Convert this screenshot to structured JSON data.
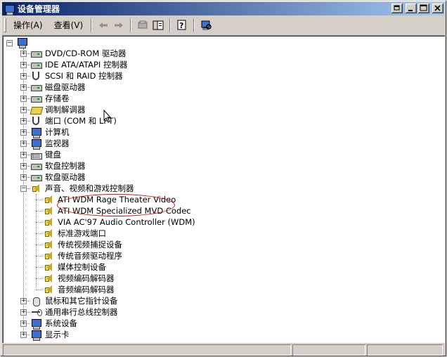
{
  "window": {
    "title": "设备管理器"
  },
  "menu": {
    "action": "操作(A)",
    "view": "查看(V)"
  },
  "toolbar": {
    "icons": [
      "back-arrow-icon",
      "forward-arrow-icon",
      "computer-properties-icon",
      "tree-view-icon",
      "help-icon",
      "scan-hardware-icon"
    ]
  },
  "tree": {
    "categories": [
      {
        "label": "DVD/CD-ROM 驱动器",
        "icon": "cdrom-icon",
        "expanded": false
      },
      {
        "label": "IDE ATA/ATAPI 控制器",
        "icon": "ide-controller-icon",
        "expanded": false
      },
      {
        "label": "SCSI 和 RAID 控制器",
        "icon": "scsi-icon",
        "expanded": false
      },
      {
        "label": "磁盘驱动器",
        "icon": "disk-drive-icon",
        "expanded": false
      },
      {
        "label": "存储卷",
        "icon": "storage-volume-icon",
        "expanded": false
      },
      {
        "label": "调制解调器",
        "icon": "modem-icon",
        "expanded": false
      },
      {
        "label": "端口 (COM 和 LPT)",
        "icon": "port-icon",
        "expanded": false
      },
      {
        "label": "计算机",
        "icon": "computer-icon",
        "expanded": false
      },
      {
        "label": "监视器",
        "icon": "monitor-icon",
        "expanded": false
      },
      {
        "label": "键盘",
        "icon": "keyboard-icon",
        "expanded": false
      },
      {
        "label": "软盘控制器",
        "icon": "floppy-controller-icon",
        "expanded": false
      },
      {
        "label": "软盘驱动器",
        "icon": "floppy-drive-icon",
        "expanded": false
      },
      {
        "label": "声音、视频和游戏控制器",
        "icon": "sound-icon",
        "expanded": true
      },
      {
        "label": "鼠标和其它指针设备",
        "icon": "mouse-icon",
        "expanded": false
      },
      {
        "label": "通用串行总线控制器",
        "icon": "usb-icon",
        "expanded": false
      },
      {
        "label": "系统设备",
        "icon": "system-device-icon",
        "expanded": false
      },
      {
        "label": "显示卡",
        "icon": "display-adapter-icon",
        "expanded": false
      }
    ],
    "sound_children": [
      "ATI WDM Rage Theater Video",
      "ATI WDM Specialized MVD Codec",
      "VIA AC'97 Audio Controller (WDM)",
      "标准游戏端口",
      "传统视频捕捉设备",
      "传统音频驱动程序",
      "媒体控制设备",
      "视频编码解码器",
      "音频编码解码器"
    ]
  },
  "colors": {
    "title_start": "#0a246a",
    "title_end": "#a6caf0",
    "face": "#d4d0c8",
    "annotation": "#d01010"
  }
}
